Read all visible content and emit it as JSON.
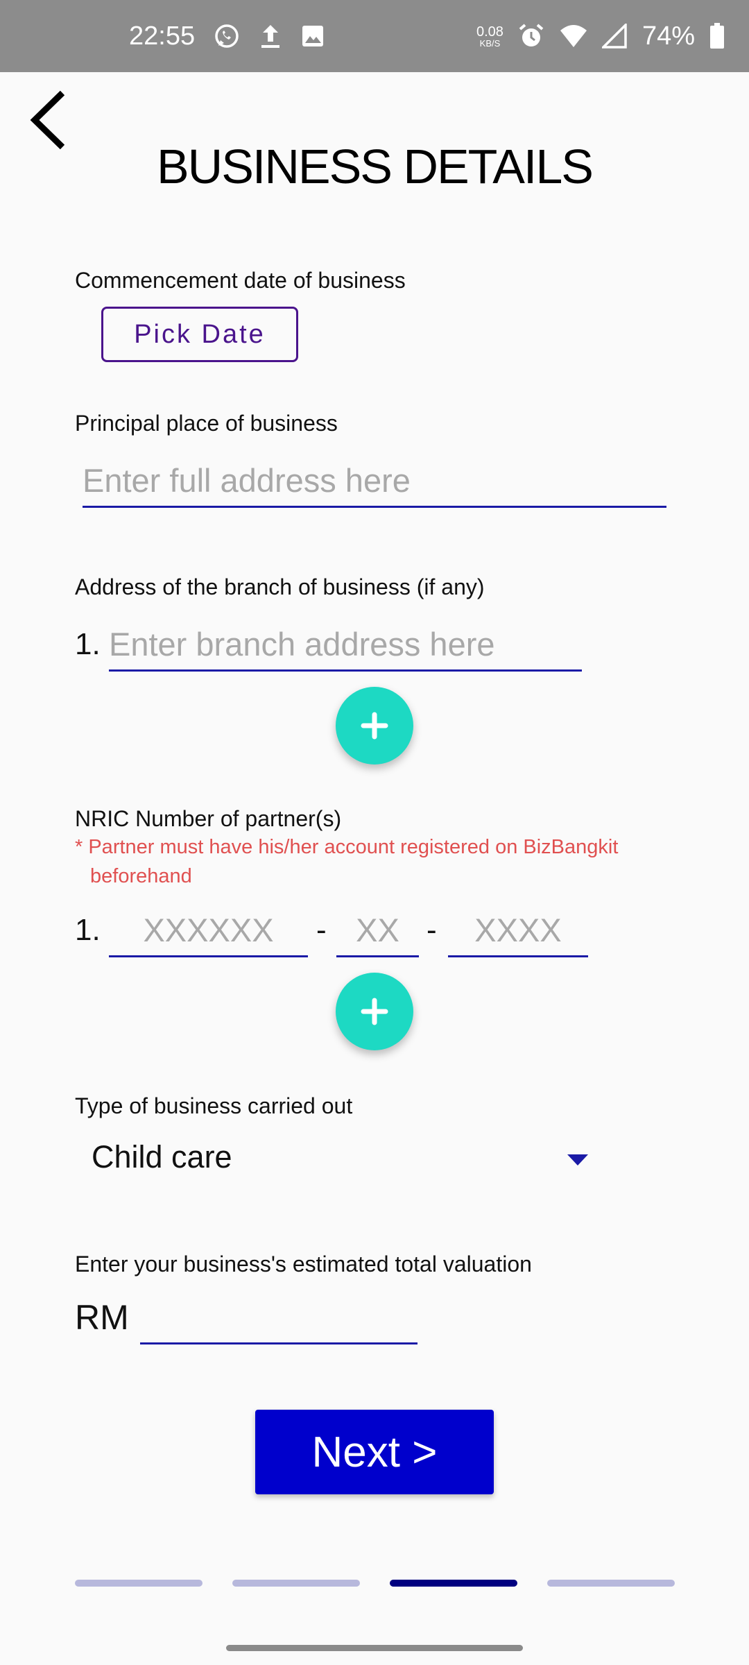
{
  "status_bar": {
    "time": "22:55",
    "net_speed_value": "0.08",
    "net_speed_unit": "KB/S",
    "battery": "74%",
    "icons": [
      "whatsapp-icon",
      "upload-icon",
      "image-icon",
      "alarm-icon",
      "wifi-icon",
      "signal-icon",
      "battery-icon"
    ]
  },
  "header": {
    "title": "BUSINESS DETAILS"
  },
  "form": {
    "commencement": {
      "label": "Commencement date of business",
      "button": "Pick Date"
    },
    "principal_place": {
      "label": "Principal place of business",
      "placeholder": "Enter full address here"
    },
    "branch": {
      "label": "Address of the branch of business (if any)",
      "index": "1.",
      "placeholder": "Enter branch address here"
    },
    "nric": {
      "label": "NRIC Number of partner(s)",
      "hint_line1": "* Partner must have his/her account registered on BizBangkit",
      "hint_line2": "beforehand",
      "index": "1.",
      "placeholder_1": "XXXXXX",
      "placeholder_2": "XX",
      "placeholder_3": "XXXX",
      "separator": "-"
    },
    "business_type": {
      "label": "Type of business carried out",
      "selected": "Child care"
    },
    "valuation": {
      "label": "Enter your business's estimated total valuation",
      "currency": "RM",
      "value": ""
    }
  },
  "next_button": "Next  >",
  "progress": {
    "total_steps": 4,
    "current_step": 3
  },
  "colors": {
    "accent": "#0000cc",
    "fab": "#1dd9c3",
    "pick_date_border": "#4a148c",
    "hint": "#e05050",
    "underline": "#1a1aa6"
  }
}
